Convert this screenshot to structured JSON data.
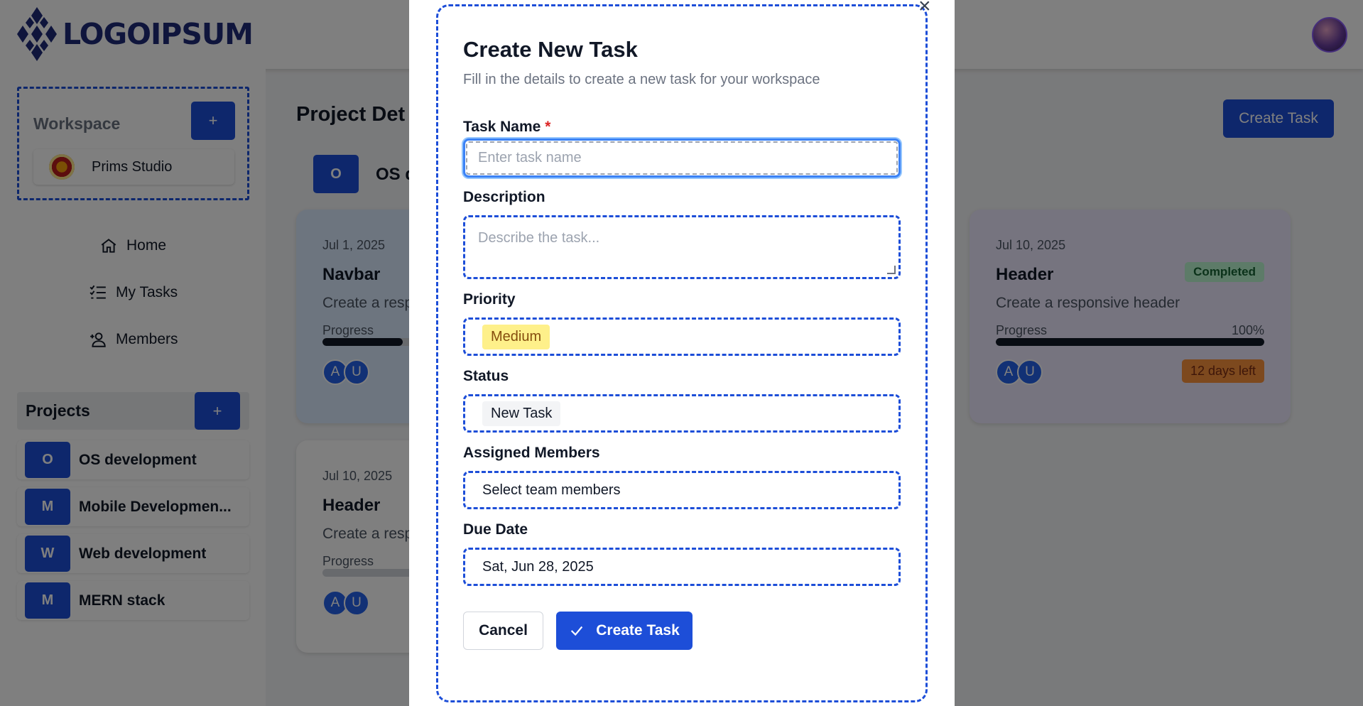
{
  "brand": {
    "logo_text": "LOGOIPSUM"
  },
  "sidebar": {
    "workspace_title": "Workspace",
    "workspace_add": "+",
    "workspace_item": "Prims Studio",
    "nav": [
      {
        "label": "Home",
        "icon": "home-icon"
      },
      {
        "label": "My Tasks",
        "icon": "list-check-icon"
      },
      {
        "label": "Members",
        "icon": "user-plus-icon"
      }
    ],
    "projects_title": "Projects",
    "projects_add": "+",
    "projects": [
      {
        "letter": "O",
        "name": "OS development"
      },
      {
        "letter": "M",
        "name": "Mobile Developmen..."
      },
      {
        "letter": "W",
        "name": "Web development"
      },
      {
        "letter": "M",
        "name": "MERN stack"
      }
    ]
  },
  "main": {
    "title": "Project Det",
    "create_task": "Create Task",
    "project_letter": "O",
    "project_name": "OS d",
    "cards": [
      {
        "date": "Jul 1, 2025",
        "title": "Navbar",
        "description": "Create a resp",
        "progress_label": "Progress",
        "progress": 0.3,
        "avatars": [
          "A",
          "U"
        ]
      },
      {
        "date": "Jul 10, 2025",
        "title": "Header",
        "badge": "Completed",
        "description": "Create a responsive header",
        "progress_label": "Progress",
        "progress_value": "100%",
        "progress": 1.0,
        "avatars": [
          "A",
          "U"
        ],
        "due": "12 days left"
      },
      {
        "date": "Jul 10, 2025",
        "title": "Header",
        "description": "Create a resp",
        "progress_label": "Progress",
        "progress": 0.0,
        "avatars": [
          "A",
          "U"
        ]
      }
    ]
  },
  "modal": {
    "title": "Create New Task",
    "subtitle": "Fill in the details to create a new task for your workspace",
    "task_name_label": "Task Name",
    "required_mark": "*",
    "task_name_placeholder": "Enter task name",
    "description_label": "Description",
    "description_placeholder": "Describe the task...",
    "priority_label": "Priority",
    "priority_value": "Medium",
    "status_label": "Status",
    "status_value": "New Task",
    "members_label": "Assigned Members",
    "members_value": "Select team members",
    "due_label": "Due Date",
    "due_value": "Sat, Jun 28, 2025",
    "cancel": "Cancel",
    "submit": "Create Task",
    "close": "×"
  },
  "colors": {
    "primary": "#1d4ed8",
    "overlay": "rgba(0,0,0,0.5)",
    "badge_completed": "#bbf7d0",
    "due_badge": "#fb923c"
  }
}
